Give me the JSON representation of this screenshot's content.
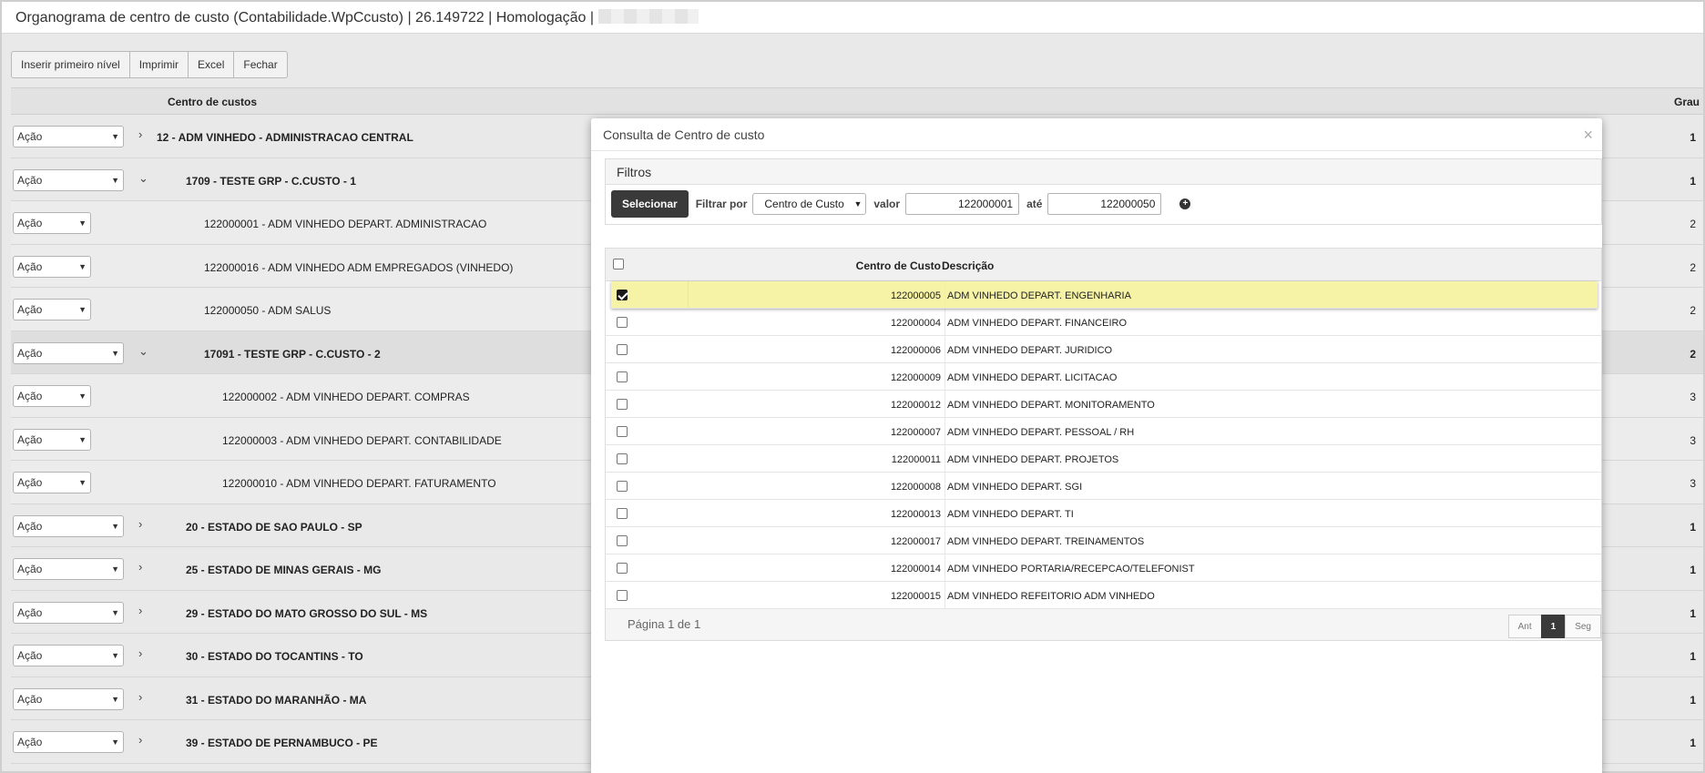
{
  "window": {
    "title": "Organograma de centro de custo (Contabilidade.WpCcusto) | 26.149722 | Homologação |"
  },
  "toolbar": {
    "insert_label": "Inserir primeiro nível",
    "print_label": "Imprimir",
    "excel_label": "Excel",
    "close_label": "Fechar"
  },
  "grid": {
    "col_centro": "Centro de custos",
    "col_grau": "Grau",
    "action_label": "Ação",
    "rows": [
      {
        "name": "12 - ADM VINHEDO - ADMINISTRACAO CENTRAL",
        "grau": "1",
        "chev": "›"
      },
      {
        "name": "1709 - TESTE GRP - C.CUSTO - 1",
        "grau": "1",
        "chev": "⌄"
      },
      {
        "name": "122000001 - ADM VINHEDO DEPART. ADMINISTRACAO",
        "grau": "2"
      },
      {
        "name": "122000016 - ADM VINHEDO ADM EMPREGADOS (VINHEDO)",
        "grau": "2"
      },
      {
        "name": "122000050 - ADM SALUS",
        "grau": "2"
      },
      {
        "name": "17091 - TESTE GRP - C.CUSTO - 2",
        "grau": "2",
        "chev": "⌄"
      },
      {
        "name": "122000002 - ADM VINHEDO DEPART. COMPRAS",
        "grau": "3"
      },
      {
        "name": "122000003 - ADM VINHEDO DEPART. CONTABILIDADE",
        "grau": "3"
      },
      {
        "name": "122000010 - ADM VINHEDO DEPART. FATURAMENTO",
        "grau": "3"
      },
      {
        "name": "20 - ESTADO DE SAO PAULO - SP",
        "grau": "1",
        "chev": "›"
      },
      {
        "name": "25 - ESTADO DE MINAS GERAIS - MG",
        "grau": "1",
        "chev": "›"
      },
      {
        "name": "29 - ESTADO DO MATO GROSSO DO SUL - MS",
        "grau": "1",
        "chev": "›"
      },
      {
        "name": "30 - ESTADO DO TOCANTINS - TO",
        "grau": "1",
        "chev": "›"
      },
      {
        "name": "31 - ESTADO DO MARANHÃO - MA",
        "grau": "1",
        "chev": "›"
      },
      {
        "name": "39 - ESTADO DE PERNAMBUCO - PE",
        "grau": "1",
        "chev": "›"
      }
    ]
  },
  "modal": {
    "title": "Consulta de Centro de custo",
    "close_glyph": "×",
    "filters_title": "Filtros",
    "select_button": "Selecionar",
    "filter_by_label": "Filtrar por",
    "filter_by_value": "Centro de Custo",
    "value_label": "valor",
    "value_from": "122000001",
    "until_label": "até",
    "value_to": "122000050",
    "add_glyph": "+",
    "col_code": "Centro de Custo",
    "col_desc": "Descrição",
    "results": [
      {
        "code": "122000005",
        "desc": "ADM VINHEDO DEPART. ENGENHARIA",
        "checked": true
      },
      {
        "code": "122000004",
        "desc": "ADM VINHEDO DEPART. FINANCEIRO",
        "checked": false
      },
      {
        "code": "122000006",
        "desc": "ADM VINHEDO DEPART. JURIDICO",
        "checked": false
      },
      {
        "code": "122000009",
        "desc": "ADM VINHEDO DEPART. LICITACAO",
        "checked": false
      },
      {
        "code": "122000012",
        "desc": "ADM VINHEDO DEPART. MONITORAMENTO",
        "checked": false
      },
      {
        "code": "122000007",
        "desc": "ADM VINHEDO DEPART. PESSOAL / RH",
        "checked": false
      },
      {
        "code": "122000011",
        "desc": "ADM VINHEDO DEPART. PROJETOS",
        "checked": false
      },
      {
        "code": "122000008",
        "desc": "ADM VINHEDO DEPART. SGI",
        "checked": false
      },
      {
        "code": "122000013",
        "desc": "ADM VINHEDO DEPART. TI",
        "checked": false
      },
      {
        "code": "122000017",
        "desc": "ADM VINHEDO DEPART. TREINAMENTOS",
        "checked": false
      },
      {
        "code": "122000014",
        "desc": "ADM VINHEDO PORTARIA/RECEPCAO/TELEFONIST",
        "checked": false
      },
      {
        "code": "122000015",
        "desc": "ADM VINHEDO REFEITORIO ADM VINHEDO",
        "checked": false
      }
    ],
    "page_info": "Página 1 de 1",
    "pager_prev": "Ant",
    "pager_current": "1",
    "pager_next": "Seg"
  }
}
